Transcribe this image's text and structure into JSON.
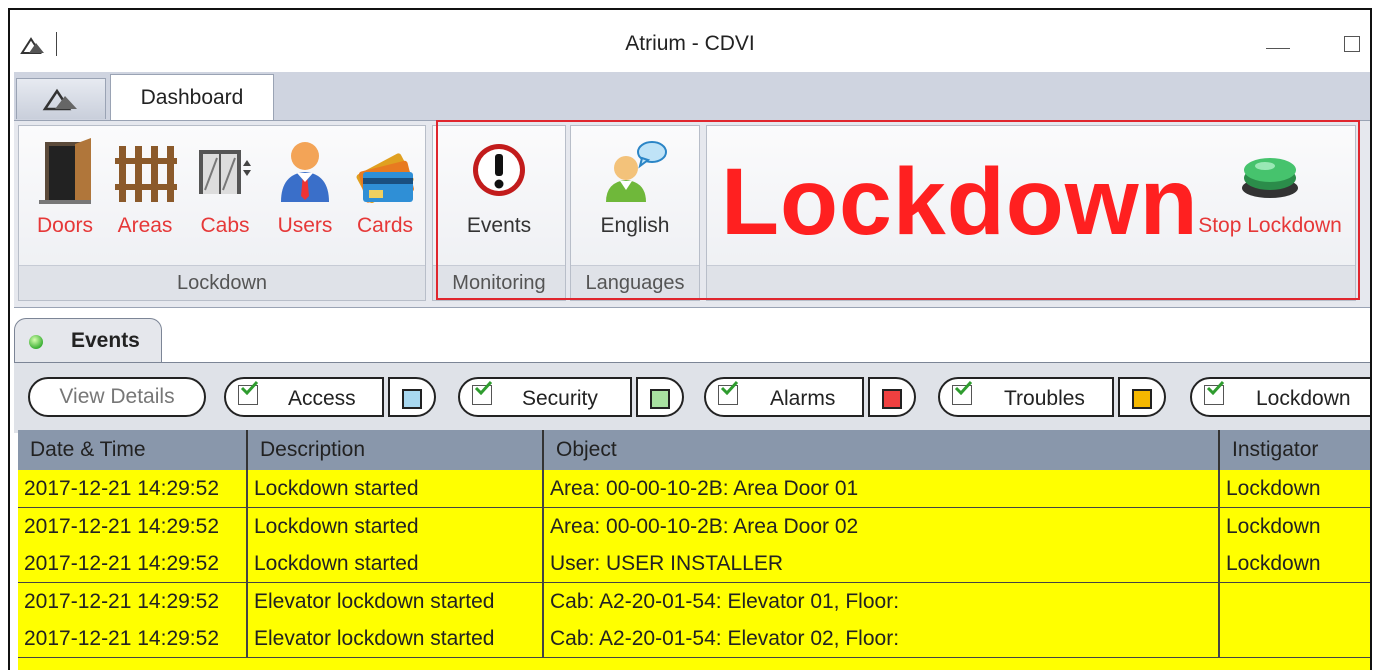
{
  "window": {
    "title": "Atrium - CDVI"
  },
  "tabs": {
    "dashboard": "Dashboard"
  },
  "ribbon": {
    "lockdown_group": {
      "label": "Lockdown",
      "buttons": [
        {
          "label": "Doors",
          "icon": "door-icon"
        },
        {
          "label": "Areas",
          "icon": "fence-icon"
        },
        {
          "label": "Cabs",
          "icon": "elevator-icon"
        },
        {
          "label": "Users",
          "icon": "user-icon"
        },
        {
          "label": "Cards",
          "icon": "cards-icon"
        }
      ]
    },
    "monitoring_group": {
      "label": "Monitoring",
      "events_label": "Events"
    },
    "languages_group": {
      "label": "Languages",
      "english_label": "English"
    },
    "lockdown_status": {
      "text": "Lockdown",
      "stop_label": "Stop Lockdown"
    }
  },
  "events_panel": {
    "tab_label": "Events",
    "view_details": "View Details",
    "filters": [
      {
        "label": "Access",
        "color": "#a8d8f0",
        "checked": true
      },
      {
        "label": "Security",
        "color": "#a8e0a0",
        "checked": true
      },
      {
        "label": "Alarms",
        "color": "#f04040",
        "checked": true
      },
      {
        "label": "Troubles",
        "color": "#f5b800",
        "checked": true
      },
      {
        "label": "Lockdown",
        "checked": true
      }
    ],
    "columns": [
      "Date & Time",
      "Description",
      "Object",
      "Instigator"
    ],
    "rows": [
      [
        "2017-12-21 14:29:52",
        "Lockdown started",
        "Area: 00-00-10-2B: Area Door 01",
        "Lockdown"
      ],
      [
        "2017-12-21 14:29:52",
        "Lockdown started",
        "Area: 00-00-10-2B: Area Door 02",
        "Lockdown"
      ],
      [
        "2017-12-21 14:29:52",
        "Lockdown started",
        "User: USER INSTALLER",
        "Lockdown"
      ],
      [
        "2017-12-21 14:29:52",
        "Elevator lockdown started",
        "Cab: A2-20-01-54: Elevator 01, Floor:",
        ""
      ],
      [
        "2017-12-21 14:29:52",
        "Elevator lockdown started",
        "Cab: A2-20-01-54: Elevator 02, Floor:",
        ""
      ]
    ],
    "row_color": "#ffff00"
  },
  "colors": {
    "lockdown_red": "#ff2020",
    "highlight_border": "#e0262e"
  }
}
